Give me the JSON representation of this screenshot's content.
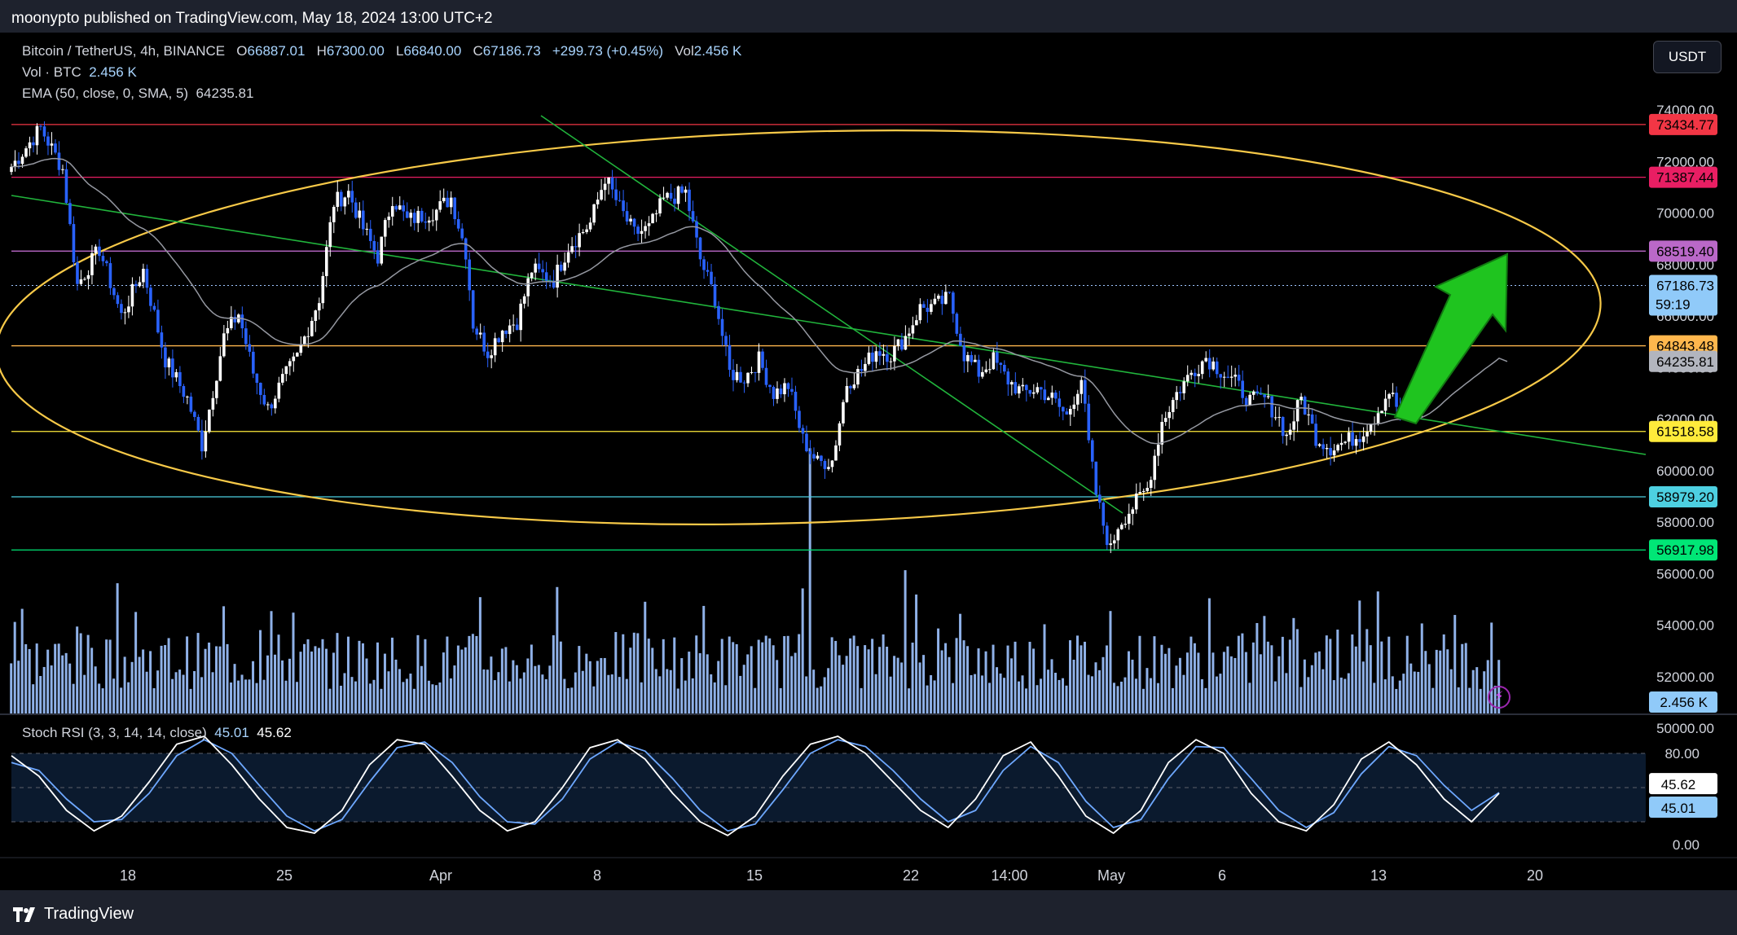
{
  "header": {
    "title": "moonypto published on TradingView.com, May 18, 2024 13:00 UTC+2"
  },
  "legend": {
    "symbol": "Bitcoin / TetherUS, 4h, BINANCE",
    "o_label": "O",
    "o": "66887.01",
    "h_label": "H",
    "h": "67300.00",
    "l_label": "L",
    "l": "66840.00",
    "c_label": "C",
    "c": "67186.73",
    "change": "+299.73 (+0.45%)",
    "vol_label": "Vol",
    "vol": "2.456 K",
    "vol_btc_label": "Vol · BTC",
    "vol_btc": "2.456 K",
    "ema_label": "EMA (50, close, 0, SMA, 5)",
    "ema": "64235.81",
    "stoch_label": "Stoch RSI (3, 3, 14, 14, close)",
    "stoch_k": "45.01",
    "stoch_d": "45.62"
  },
  "currency_button": "USDT",
  "footer": {
    "brand": "TradingView"
  },
  "colors": {
    "bg": "#000000",
    "candle_up": "#ffffff",
    "candle_down": "#2962ff",
    "volume": "#8fb1e8",
    "ellipse": "#f7c948",
    "channel": "#21b43c",
    "ema": "#9598a1",
    "arrow": "#1fc41f",
    "stoch_k": "#ffffff",
    "stoch_d": "#6ea8ff",
    "stoch_band": "#0b1a2e"
  },
  "chart_data": {
    "type": "candlestick",
    "title": "Bitcoin / TetherUS, 4h, BINANCE",
    "x_ticks": [
      "18",
      "25",
      "Apr",
      "8",
      "15",
      "22",
      "14:00",
      "May",
      "6",
      "13",
      "20"
    ],
    "y_ticks": [
      74000,
      72000,
      70000,
      68000,
      66000,
      64000,
      62000,
      60000,
      58000,
      56000,
      54000,
      52000,
      50000
    ],
    "ylim": [
      49000,
      75000
    ],
    "last_price": 67186.73,
    "countdown": "59:19",
    "ema_value": 64235.81,
    "volume_last": "2.456 K",
    "horizontal_levels": [
      {
        "price": 73434.77,
        "label": "73434.77",
        "color": "#f23645"
      },
      {
        "price": 71387.44,
        "label": "71387.44",
        "color": "#e91e63"
      },
      {
        "price": 68519.4,
        "label": "68519.40",
        "color": "#ba68c8"
      },
      {
        "price": 64843.48,
        "label": "64843.48",
        "color": "#ffb74d"
      },
      {
        "price": 61518.58,
        "label": "61518.58",
        "color": "#ffeb3b"
      },
      {
        "price": 58979.2,
        "label": "58979.20",
        "color": "#4dd0e1"
      },
      {
        "price": 56917.98,
        "label": "56917.98",
        "color": "#00e676"
      }
    ],
    "price_path": [
      [
        0,
        71800
      ],
      [
        8,
        73300
      ],
      [
        14,
        71700
      ],
      [
        18,
        67200
      ],
      [
        24,
        68600
      ],
      [
        30,
        66000
      ],
      [
        36,
        67800
      ],
      [
        42,
        64300
      ],
      [
        48,
        62800
      ],
      [
        52,
        61000
      ],
      [
        58,
        65200
      ],
      [
        62,
        66100
      ],
      [
        66,
        63800
      ],
      [
        70,
        62400
      ],
      [
        74,
        63500
      ],
      [
        78,
        64400
      ],
      [
        84,
        66700
      ],
      [
        88,
        70400
      ],
      [
        92,
        70800
      ],
      [
        96,
        69400
      ],
      [
        100,
        68300
      ],
      [
        104,
        70600
      ],
      [
        108,
        69700
      ],
      [
        112,
        69900
      ],
      [
        116,
        70100
      ],
      [
        120,
        70600
      ],
      [
        124,
        68500
      ],
      [
        126,
        65700
      ],
      [
        130,
        64600
      ],
      [
        134,
        65500
      ],
      [
        138,
        65800
      ],
      [
        142,
        67800
      ],
      [
        148,
        67400
      ],
      [
        152,
        68700
      ],
      [
        158,
        69600
      ],
      [
        162,
        71400
      ],
      [
        166,
        70200
      ],
      [
        170,
        69200
      ],
      [
        174,
        69400
      ],
      [
        178,
        70500
      ],
      [
        184,
        70800
      ],
      [
        188,
        68200
      ],
      [
        192,
        66700
      ],
      [
        196,
        63800
      ],
      [
        200,
        63600
      ],
      [
        204,
        64300
      ],
      [
        208,
        63000
      ],
      [
        212,
        63300
      ],
      [
        216,
        61200
      ],
      [
        220,
        60300
      ],
      [
        224,
        60400
      ],
      [
        228,
        63400
      ],
      [
        232,
        63900
      ],
      [
        236,
        64700
      ],
      [
        240,
        64500
      ],
      [
        244,
        65200
      ],
      [
        248,
        66300
      ],
      [
        252,
        66400
      ],
      [
        256,
        66700
      ],
      [
        260,
        64500
      ],
      [
        264,
        63800
      ],
      [
        268,
        64300
      ],
      [
        272,
        63500
      ],
      [
        276,
        63000
      ],
      [
        280,
        63200
      ],
      [
        284,
        62800
      ],
      [
        288,
        62100
      ],
      [
        292,
        63600
      ],
      [
        294,
        61000
      ],
      [
        296,
        59100
      ],
      [
        298,
        57900
      ],
      [
        300,
        56900
      ],
      [
        302,
        57900
      ],
      [
        306,
        58600
      ],
      [
        310,
        59300
      ],
      [
        314,
        61900
      ],
      [
        318,
        63000
      ],
      [
        322,
        63800
      ],
      [
        326,
        64400
      ],
      [
        330,
        63900
      ],
      [
        334,
        63400
      ],
      [
        338,
        62700
      ],
      [
        342,
        62800
      ],
      [
        346,
        62000
      ],
      [
        348,
        61300
      ],
      [
        352,
        62800
      ],
      [
        356,
        61300
      ],
      [
        360,
        60900
      ],
      [
        364,
        61100
      ],
      [
        368,
        61400
      ],
      [
        372,
        62100
      ],
      [
        376,
        63100
      ],
      [
        380,
        61900
      ],
      [
        384,
        62400
      ],
      [
        388,
        64800
      ],
      [
        392,
        66100
      ],
      [
        396,
        65900
      ],
      [
        400,
        66500
      ],
      [
        404,
        66800
      ],
      [
        406,
        67200
      ]
    ],
    "stoch": {
      "k": [
        78,
        60,
        30,
        12,
        25,
        55,
        88,
        95,
        70,
        40,
        15,
        10,
        30,
        70,
        92,
        88,
        60,
        30,
        12,
        20,
        50,
        85,
        92,
        75,
        45,
        20,
        8,
        25,
        60,
        88,
        95,
        80,
        55,
        30,
        15,
        40,
        78,
        90,
        60,
        25,
        10,
        30,
        72,
        92,
        80,
        45,
        20,
        12,
        35,
        75,
        90,
        70,
        40,
        20,
        45.01
      ],
      "d": [
        72,
        65,
        40,
        20,
        22,
        45,
        78,
        92,
        80,
        52,
        25,
        12,
        22,
        55,
        85,
        90,
        72,
        42,
        20,
        18,
        40,
        75,
        90,
        82,
        58,
        30,
        12,
        18,
        48,
        80,
        92,
        86,
        65,
        40,
        20,
        30,
        65,
        86,
        72,
        38,
        15,
        22,
        58,
        86,
        85,
        58,
        30,
        15,
        28,
        62,
        86,
        78,
        52,
        30,
        45.62
      ],
      "y_ticks": [
        80.0,
        0.0
      ],
      "band": [
        20,
        80
      ]
    }
  }
}
